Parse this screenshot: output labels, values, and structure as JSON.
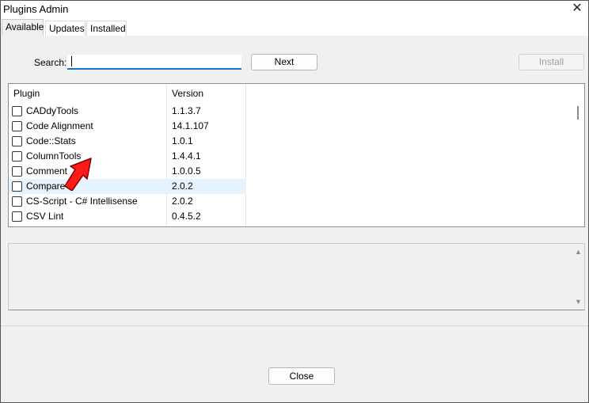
{
  "window": {
    "title": "Plugins Admin"
  },
  "tabs": [
    {
      "label": "Available",
      "active": true
    },
    {
      "label": "Updates",
      "active": false
    },
    {
      "label": "Installed",
      "active": false
    }
  ],
  "search": {
    "label": "Search:",
    "value": ""
  },
  "buttons": {
    "next": "Next",
    "install": "Install",
    "close": "Close"
  },
  "list": {
    "columns": [
      "Plugin",
      "Version"
    ],
    "rows": [
      {
        "name": "CADdyTools",
        "version": "1.1.3.7"
      },
      {
        "name": "Code Alignment",
        "version": "14.1.107"
      },
      {
        "name": "Code::Stats",
        "version": "1.0.1"
      },
      {
        "name": "ColumnTools",
        "version": "1.4.4.1"
      },
      {
        "name": "Comment",
        "version": "1.0.0.5"
      },
      {
        "name": "Compare",
        "version": "2.0.2",
        "highlighted": true
      },
      {
        "name": "CS-Script - C# Intellisense",
        "version": "2.0.2"
      },
      {
        "name": "CSV Lint",
        "version": "0.4.5.2"
      }
    ]
  },
  "annotation": {
    "icon": "red-arrow-icon",
    "color": "#ff0000"
  }
}
